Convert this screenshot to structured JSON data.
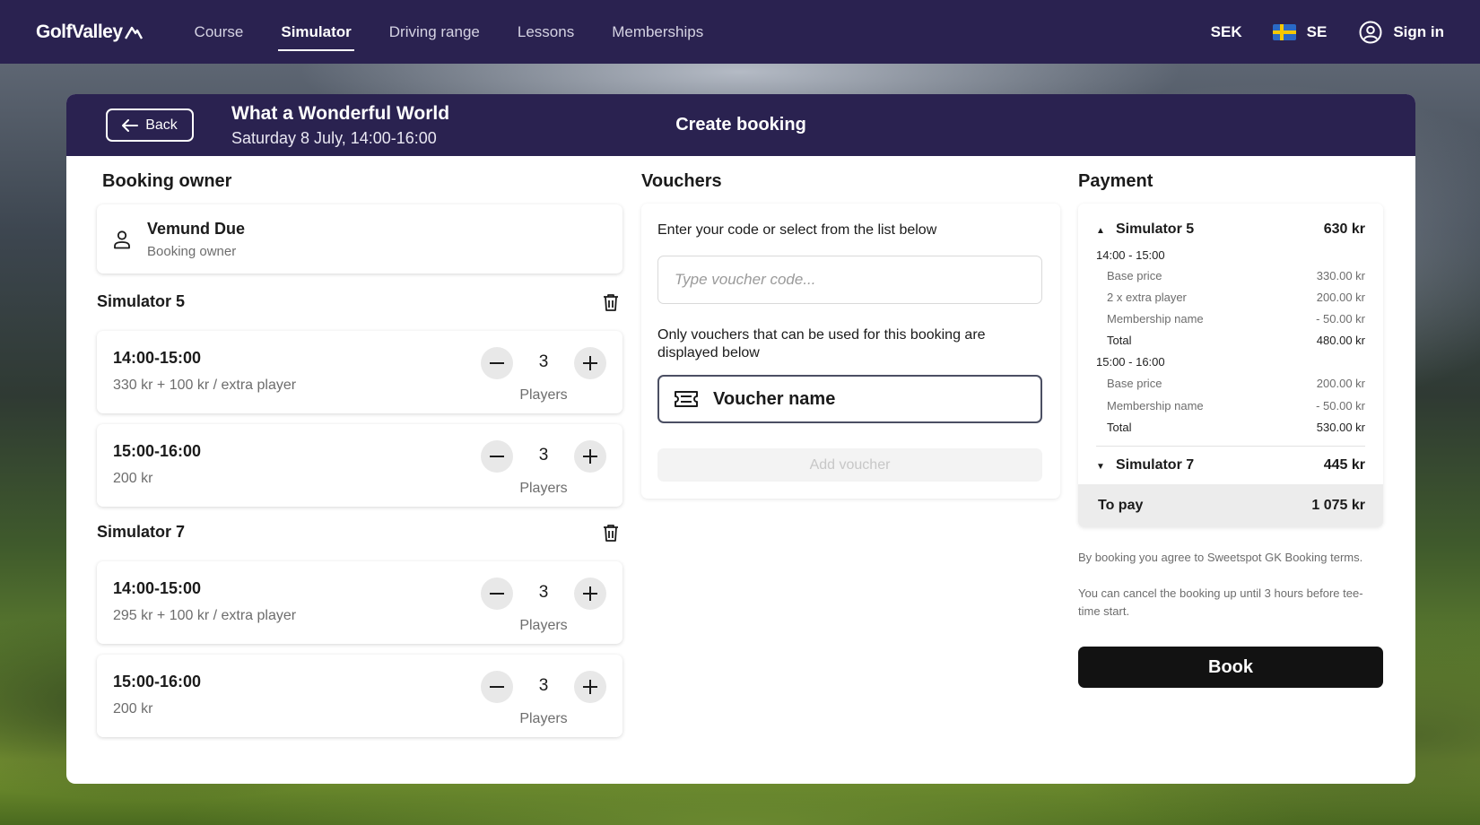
{
  "nav": {
    "logo": "GolfValley",
    "links": [
      "Course",
      "Simulator",
      "Driving range",
      "Lessons",
      "Memberships"
    ],
    "currency": "SEK",
    "language": "SE",
    "sign_in": "Sign in"
  },
  "header": {
    "back": "Back",
    "event_title": "What a Wonderful World",
    "event_date": "Saturday 8 July, 14:00-16:00",
    "title": "Create booking"
  },
  "owner": {
    "section_title": "Booking owner",
    "name": "Vemund Due",
    "role": "Booking owner"
  },
  "simulators": [
    {
      "name": "Simulator 5",
      "slots": [
        {
          "time": "14:00-15:00",
          "price": "330 kr + 100 kr / extra player",
          "players": "3",
          "players_label": "Players"
        },
        {
          "time": "15:00-16:00",
          "price": "200 kr",
          "players": "3",
          "players_label": "Players"
        }
      ]
    },
    {
      "name": "Simulator 7",
      "slots": [
        {
          "time": "14:00-15:00",
          "price": "295 kr  + 100 kr / extra player",
          "players": "3",
          "players_label": "Players"
        },
        {
          "time": "15:00-16:00",
          "price": "200 kr",
          "players": "3",
          "players_label": "Players"
        }
      ]
    }
  ],
  "vouchers": {
    "section_title": "Vouchers",
    "instruction": "Enter your code or select from the list below",
    "placeholder": "Type voucher code...",
    "note": "Only vouchers that can be used for this booking are displayed below",
    "item": "Voucher name",
    "add": "Add voucher"
  },
  "payment": {
    "section_title": "Payment",
    "sim5": {
      "name": "Simulator 5",
      "amount": "630 kr",
      "slot1": "14:00 - 15:00",
      "slot1_lines": [
        {
          "label": "Base price",
          "value": "330.00 kr"
        },
        {
          "label": "2 x extra player",
          "value": "200.00 kr"
        },
        {
          "label": "Membership name",
          "value": "- 50.00 kr"
        }
      ],
      "slot1_total": {
        "label": "Total",
        "value": "480.00 kr"
      },
      "slot2": "15:00 - 16:00",
      "slot2_lines": [
        {
          "label": "Base price",
          "value": "200.00 kr"
        },
        {
          "label": "Membership name",
          "value": "- 50.00 kr"
        }
      ],
      "slot2_total": {
        "label": "Total",
        "value": "530.00 kr"
      }
    },
    "sim7": {
      "name": "Simulator 7",
      "amount": "445 kr"
    },
    "to_pay_label": "To pay",
    "to_pay_value": "1 075 kr",
    "terms": "By booking you agree to Sweetspot GK Booking terms.",
    "cancel": "You can cancel the booking up until 3 hours before tee-time start.",
    "book": "Book"
  },
  "colors": {
    "brand": "#2a2250",
    "book_button": "#121212"
  }
}
